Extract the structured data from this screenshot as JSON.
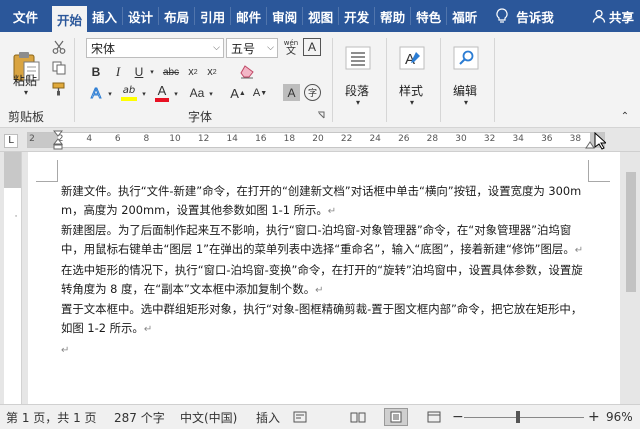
{
  "tabs": [
    {
      "id": "file",
      "label": "文件"
    },
    {
      "id": "home",
      "label": "开始"
    },
    {
      "id": "insert",
      "label": "插入"
    },
    {
      "id": "design",
      "label": "设计"
    },
    {
      "id": "layout",
      "label": "布局"
    },
    {
      "id": "references",
      "label": "引用"
    },
    {
      "id": "mailings",
      "label": "邮件"
    },
    {
      "id": "review",
      "label": "审阅"
    },
    {
      "id": "view",
      "label": "视图"
    },
    {
      "id": "developer",
      "label": "开发"
    },
    {
      "id": "help",
      "label": "帮助"
    },
    {
      "id": "special",
      "label": "特色"
    },
    {
      "id": "foxit",
      "label": "福昕"
    }
  ],
  "tell_me": "告诉我",
  "share": "共享",
  "ribbon": {
    "clipboard": {
      "paste_label": "粘贴",
      "group_label": "剪贴板"
    },
    "font": {
      "font_name": "宋体",
      "font_size": "五号",
      "wen_top": "wén",
      "wen_bottom": "文",
      "box_a": "A",
      "bold": "B",
      "italic": "I",
      "underline": "U",
      "strike": "abc",
      "subscript": "x",
      "superscript": "x",
      "text_effect": "A",
      "highlight_glyph": "ab",
      "font_color": "A",
      "change_case": "Aa",
      "grow": "A",
      "shrink": "A",
      "char_shading": "A",
      "enclose": "字",
      "group_label": "字体"
    },
    "paragraph": {
      "label": "段落"
    },
    "styles": {
      "label": "样式"
    },
    "editing": {
      "label": "编辑"
    }
  },
  "ruler": {
    "tab_stop": "L",
    "numbers": [
      2,
      2,
      4,
      6,
      8,
      10,
      12,
      14,
      16,
      18,
      20,
      22,
      24,
      26,
      28,
      30,
      32,
      34,
      36,
      38
    ]
  },
  "document": {
    "paragraphs": [
      "新建文件。执行“文件-新建”命令，在打开的“创建新文档”对话框中单击“横向”按钮，设置宽度为 300mm，高度为 200mm，设置其他参数如图 1-1 所示。",
      "新建图层。为了后面制作起来互不影响，执行“窗口-泊坞窗-对象管理器”命令，在“对象管理器”泊坞窗中，用鼠标右键单击“图层 1”在弹出的菜单列表中选择“重命名”，输入“底图”，接着新建“修饰”图层。",
      "在选中矩形的情况下，执行“窗口-泊坞窗-变换”命令，在打开的“旋转”泊坞窗中，设置具体参数，设置旋转角度为 8 度，在“副本”文本框中添加复制个数。",
      "置于文本框中。选中群组矩形对象，执行“对象-图框精确剪裁-置于图文框内部”命令，把它放在矩形中，如图 1-2 所示。"
    ],
    "para_mark": "↵"
  },
  "status": {
    "page": "第 1 页，共 1 页",
    "words": "287 个字",
    "language": "中文(中国)",
    "mode": "插入",
    "zoom_out": "−",
    "zoom_in": "+",
    "zoom": "96%"
  },
  "colors": {
    "accent": "#2b579a",
    "highlight": "#ffff00",
    "font_color": "#e81123"
  }
}
